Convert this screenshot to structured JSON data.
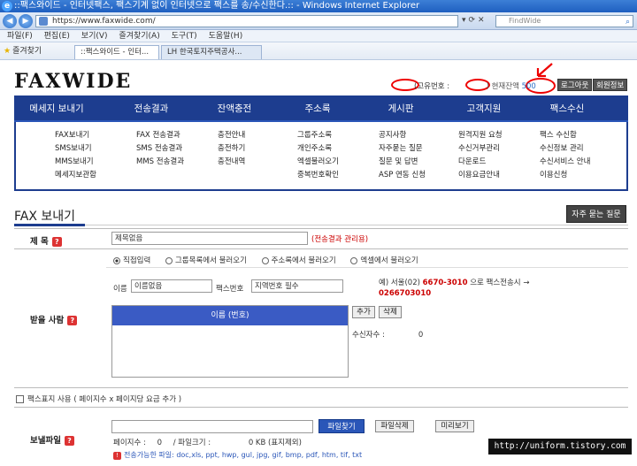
{
  "browser": {
    "title": "::팩스와이드 - 인터넷팩스, 팩스기계 없이 인터넷으로 팩스를 송/수신한다.:: - Windows Internet Explorer",
    "url": "https://www.faxwide.com/",
    "search_placeholder": "FindWide",
    "menu": [
      "파일(F)",
      "편집(E)",
      "보기(V)",
      "즐겨찾기(A)",
      "도구(T)",
      "도움말(H)"
    ],
    "favorites_label": "즐겨찾기",
    "tabs": [
      "::팩스와이드 - 인터...",
      "LH 한국토지주택공사..."
    ]
  },
  "header": {
    "logo": "FAXWIDE",
    "fax_id_label": "(고유번호 :",
    "fax_id_close": ")",
    "balance_label": "현재잔액",
    "balance_value": "500",
    "logout": "로그아웃",
    "member_info": "회원정보"
  },
  "nav": [
    {
      "label": "메세지 보내기",
      "items": [
        "FAX보내기",
        "SMS보내기",
        "MMS보내기",
        "메세지보관함"
      ]
    },
    {
      "label": "전송결과",
      "items": [
        "FAX 전송결과",
        "SMS 전송결과",
        "MMS 전송결과"
      ]
    },
    {
      "label": "잔액충전",
      "items": [
        "충전안내",
        "충전하기",
        "충전내역"
      ]
    },
    {
      "label": "주소록",
      "items": [
        "그룹주소록",
        "개인주소록",
        "엑셀불러오기",
        "중복번호확인"
      ]
    },
    {
      "label": "게시판",
      "items": [
        "공지사항",
        "자주묻는 질문",
        "질문 및 답변",
        "ASP 연동 신청"
      ]
    },
    {
      "label": "고객지원",
      "items": [
        "원격지원 요청",
        "수신거부관리",
        "다운로드",
        "이용요금안내"
      ]
    },
    {
      "label": "팩스수신",
      "items": [
        "팩스 수신함",
        "수신정보 관리",
        "수신서비스 안내",
        "이용신청"
      ]
    }
  ],
  "page": {
    "title": "FAX 보내기",
    "faq_button": "자주 묻는 질문"
  },
  "form": {
    "subject_label": "제   목",
    "subject_value": "제목없음",
    "subject_note": "(전송결과 관리용)",
    "recipient_label": "받을 사람",
    "radio_options": [
      "직접입력",
      "그룹목록에서 불러오기",
      "주소록에서 불러오기",
      "엑셀에서 불러오기"
    ],
    "name_label": "이름",
    "name_value": "이름없음",
    "fax_label": "팩스번호",
    "fax_placeholder": "지역번호 필수",
    "example_prefix": "예) 서울(02)",
    "example_number": "6670-3010",
    "example_suffix": "으로 팩스전송시 →",
    "example_result": "0266703010",
    "list_header": "이름 (번호)",
    "add_button": "추가",
    "delete_button": "삭제",
    "count_label": "수신자수 :",
    "count_value": "0",
    "cover_label": "팩스표지 사용 ( 페이지수 x 페이지당 요금 추가 )",
    "file_label": "보낼파일",
    "file_find": "파일찾기",
    "file_delete": "파일삭제",
    "preview": "미리보기",
    "page_count_label": "페이지수 :",
    "page_count_value": "0",
    "file_size_label": "/ 파일크기 :",
    "file_size_value": "0 KB (표지제외)",
    "allowed_label": "전송가능한 파일:",
    "allowed_types": "doc,xls, ppt, hwp, gul, jpg, gif, bmp, pdf, htm, tif, txt"
  },
  "watermark": "http://uniform.tistory.com"
}
